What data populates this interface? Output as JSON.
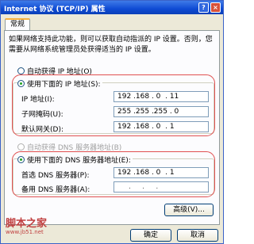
{
  "window": {
    "title": "Internet 协议 (TCP/IP) 属性",
    "help_label": "?",
    "close_label": "×"
  },
  "tabs": [
    {
      "label": "常规"
    }
  ],
  "description": "如果网络支持此功能，则可以获取自动指派的 IP 设置。否则，您需要从网络系统管理员处获得适当的 IP 设置。",
  "ip_mode": {
    "auto_label": "自动获得 IP 地址(O)",
    "manual_label": "使用下面的 IP 地址(S):",
    "selected": "manual"
  },
  "ip_fields": {
    "ip": {
      "label": "IP 地址(I):",
      "value": "192 .168 . 0  . 11"
    },
    "mask": {
      "label": "子网掩码(U):",
      "value": "255 .255 .255 . 0"
    },
    "gateway": {
      "label": "默认网关(D):",
      "value": "192 .168 . 0  . 1"
    }
  },
  "dns_mode": {
    "auto_label": "自动获得 DNS 服务器地址(B)",
    "manual_label": "使用下面的 DNS 服务器地址(E):",
    "selected": "manual"
  },
  "dns_fields": {
    "preferred": {
      "label": "首选 DNS 服务器(P):",
      "value": "192 .168 . 0  . 1"
    },
    "alternate": {
      "label": "备用 DNS 服务器(A):",
      "value": ".     .     ."
    }
  },
  "buttons": {
    "advanced": "高级(V)...",
    "ok": "确定",
    "cancel": "取消"
  },
  "watermark": {
    "text": "脚本之家",
    "url": "www.jb51.net"
  },
  "colors": {
    "titlebar": "#0f4bd4",
    "highlight": "#e05050"
  }
}
